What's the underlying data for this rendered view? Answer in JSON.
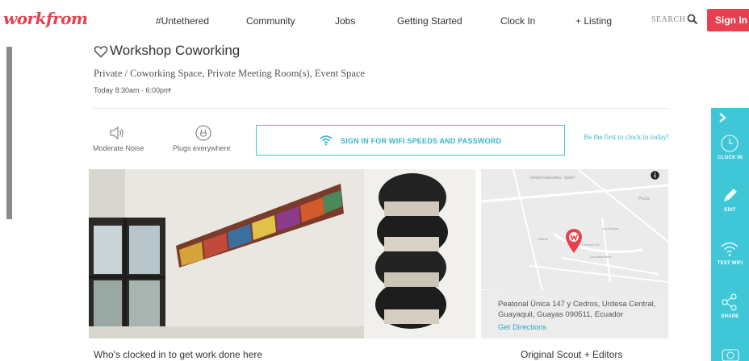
{
  "header": {
    "logo_text": "workfrom",
    "nav": [
      "#Untethered",
      "Community",
      "Jobs",
      "Getting Started",
      "Clock In",
      "+ Listing"
    ],
    "search_label": "SEARCH",
    "signin_label": "Sign In"
  },
  "listing": {
    "title": "Workshop Coworking",
    "subtitle": "Private / Coworking Space, Private Meeting Room(s), Event Space",
    "hours": "Today  8:30am - 6:00pm",
    "amenities": [
      {
        "icon": "speaker-icon",
        "label": "Moderate Noise"
      },
      {
        "icon": "plug-icon",
        "label": "Plugs everywhere"
      }
    ],
    "wifi_button": "SIGN IN FOR WIFI SPEEDS AND PASSWORD",
    "clockin_prompt": "Be the first to clock in today!"
  },
  "map": {
    "address": "Peatonal Única 147 y Cedros, Urdesa Central, Guayaquil, Guayas 090511, Ecuador",
    "directions": "Get Directions",
    "labels": [
      "Unidad Educativa \"Javier\"",
      "Pycca",
      "Las Monjas",
      "Ciruelos Sur",
      "Los Almendros",
      "Cedros"
    ]
  },
  "sections": {
    "who_clocked_in": "Who's clocked in to get work done here",
    "scout": "Original Scout + Editors"
  },
  "right_panel": {
    "items": [
      "CLOCK IN",
      "EDIT",
      "TEST WIFI",
      "SHARE"
    ]
  },
  "colors": {
    "brand_red": "#e8404e",
    "accent_teal": "#3fc7d8",
    "link_blue": "#2aa7c9"
  }
}
